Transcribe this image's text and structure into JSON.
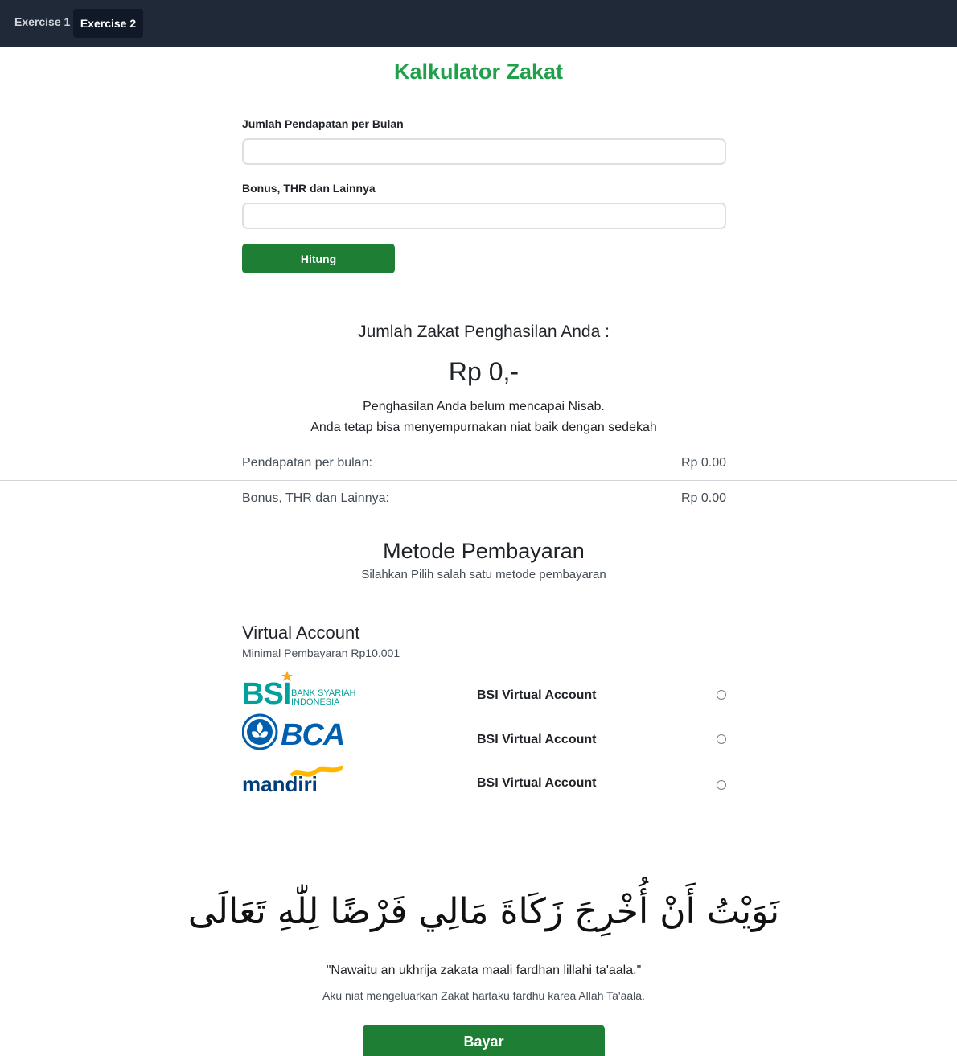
{
  "nav": {
    "tabs": [
      {
        "label": "Exercise 1"
      },
      {
        "label": "Exercise 2"
      }
    ]
  },
  "form": {
    "title": "Kalkulator Zakat",
    "income_label": "Jumlah Pendapatan per Bulan",
    "income_value": "",
    "bonus_label": "Bonus, THR dan Lainnya",
    "bonus_value": "",
    "calculate_label": "Hitung"
  },
  "result": {
    "heading": "Jumlah Zakat Penghasilan Anda :",
    "amount": "Rp 0,-",
    "message_line1": "Penghasilan Anda belum mencapai Nisab.",
    "message_line2": "Anda tetap bisa menyempurnakan niat baik dengan sedekah",
    "rows": [
      {
        "label": "Pendapatan per bulan:",
        "value": "Rp 0.00"
      },
      {
        "label": "Bonus, THR dan Lainnya:",
        "value": "Rp 0.00"
      }
    ]
  },
  "payment": {
    "title": "Metode Pembayaran",
    "subtitle": "Silahkan Pilih salah satu metode pembayaran",
    "va_title": "Virtual Account",
    "va_subtitle": "Minimal Pembayaran Rp10.001",
    "banks": [
      {
        "logo_text": "BSI",
        "logo_caption_1": "BANK SYARIAH",
        "logo_caption_2": "INDONESIA",
        "name": "BSI Virtual Account",
        "selected": false
      },
      {
        "logo_text": "BCA",
        "name": "BSI Virtual Account",
        "selected": false
      },
      {
        "logo_text": "mandiri",
        "name": "BSI Virtual Account",
        "selected": false
      }
    ]
  },
  "niat": {
    "arabic": "نَوَيْتُ أَنْ أُخْرِجَ زَكَاةَ مَالِي فَرْضًا لِلّٰهِ تَعَالَى",
    "latin": "\"Nawaitu an ukhrija zakata maali fardhan lillahi ta'aala.\"",
    "translation": "Aku niat mengeluarkan Zakat hartaku fardhu karea Allah Ta'aala."
  },
  "pay_button": {
    "label": "Bayar"
  },
  "colors": {
    "topbar": "#1f2937",
    "title_green": "#21a04b",
    "button_green": "#1e7e34",
    "bsi_teal": "#00a19a",
    "bca_blue": "#0060af",
    "mandiri_navy": "#003d79",
    "mandiri_gold": "#ffb700"
  }
}
